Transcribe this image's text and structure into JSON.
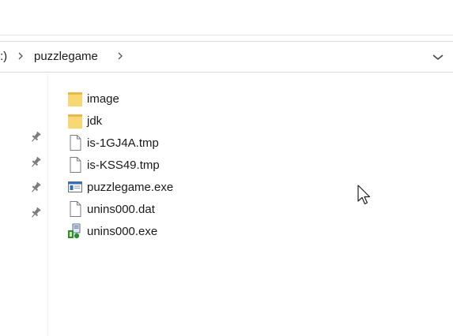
{
  "breadcrumb": {
    "drive_fragment": ":)",
    "folder": "puzzlegame"
  },
  "icons": {
    "folder": "folder-icon",
    "generic_file": "file-icon",
    "application": "application-icon",
    "installer": "installer-icon",
    "pin": "pin-icon",
    "separator": "chevron-right-icon",
    "dropdown": "chevron-down-icon",
    "cursor": "mouse-cursor-icon"
  },
  "colors": {
    "folder": "#f8d775",
    "folder_dark": "#e8b84a",
    "app_blue": "#2a6ebd",
    "installer_green": "#2f8f2f"
  },
  "files": [
    {
      "name": "image",
      "type": "folder"
    },
    {
      "name": "jdk",
      "type": "folder"
    },
    {
      "name": "is-1GJ4A.tmp",
      "type": "file"
    },
    {
      "name": "is-KSS49.tmp",
      "type": "file"
    },
    {
      "name": "puzzlegame.exe",
      "type": "application"
    },
    {
      "name": "unins000.dat",
      "type": "file"
    },
    {
      "name": "unins000.exe",
      "type": "installer"
    }
  ]
}
